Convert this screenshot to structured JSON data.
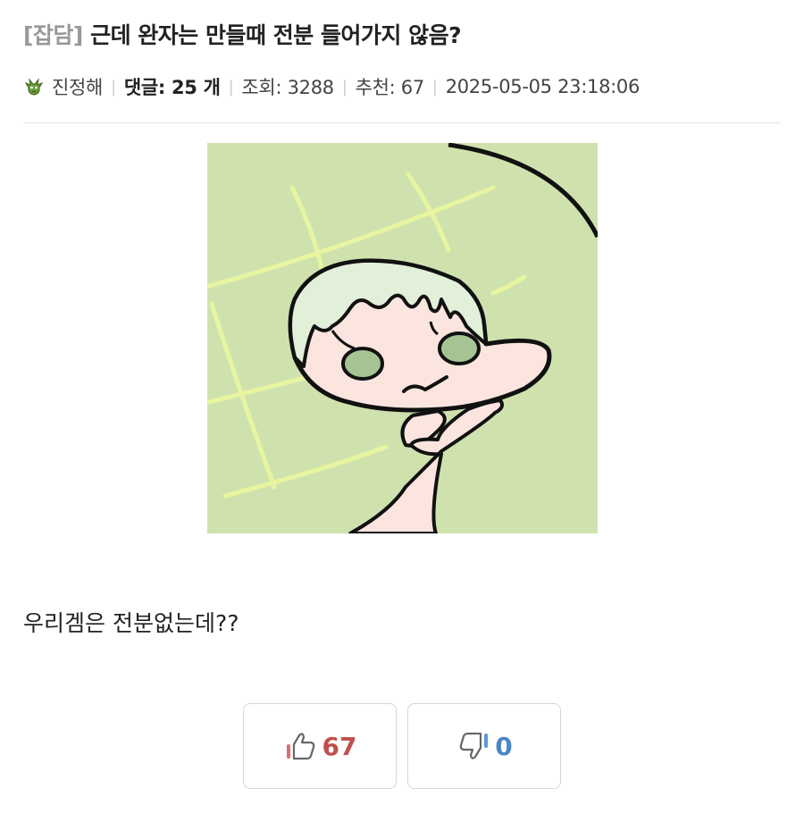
{
  "post": {
    "category": "[잡담]",
    "title": "근데 완자는 만들때 전분 들어가지 않음?",
    "author": "진정해",
    "comments_label": "댓글: 25 개",
    "views_label": "조회: 3288",
    "recommend_label": "추천: 67",
    "datetime": "2025-05-05 23:18:06",
    "body": "우리겜은 전분없는데??"
  },
  "votes": {
    "up_count": "67",
    "down_count": "0"
  },
  "colors": {
    "image_bg": "#cfe2ae",
    "grid_lines": "#e8f5a0",
    "up_accent": "#c0504d",
    "down_accent": "#4a86c5"
  },
  "icons": {
    "author": "green-goblin-avatar-icon",
    "up": "thumbs-up-icon",
    "down": "thumbs-down-icon"
  }
}
